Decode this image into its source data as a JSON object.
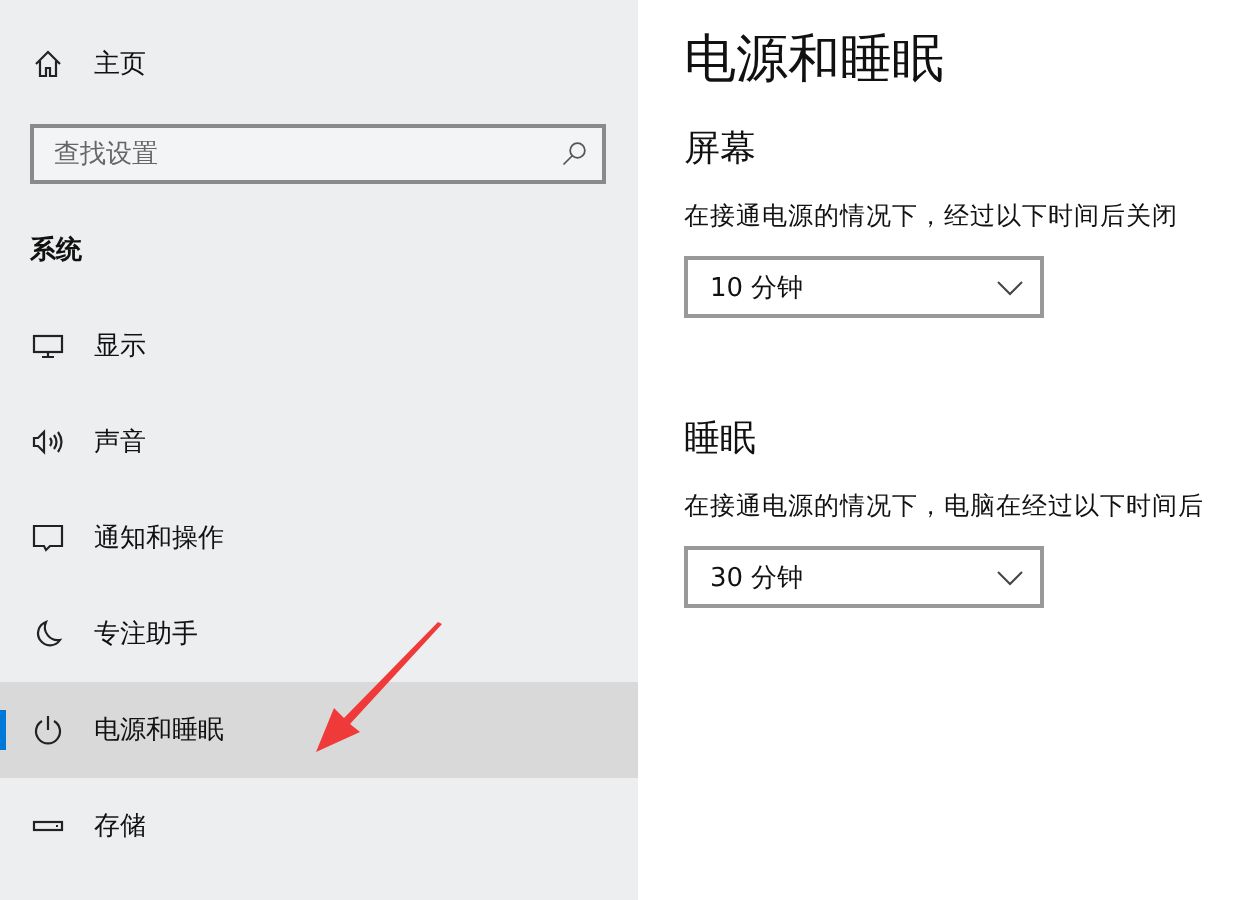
{
  "sidebar": {
    "home": "主页",
    "search": {
      "placeholder": "查找设置"
    },
    "section": "系统",
    "items": [
      {
        "label": "显示",
        "selected": false
      },
      {
        "label": "声音",
        "selected": false
      },
      {
        "label": "通知和操作",
        "selected": false
      },
      {
        "label": "专注助手",
        "selected": false
      },
      {
        "label": "电源和睡眠",
        "selected": true
      },
      {
        "label": "存储",
        "selected": false
      }
    ]
  },
  "main": {
    "title": "电源和睡眠",
    "sections": [
      {
        "heading": "屏幕",
        "label": "在接通电源的情况下，经过以下时间后关闭",
        "value": "10 分钟"
      },
      {
        "heading": "睡眠",
        "label": "在接通电源的情况下，电脑在经过以下时间后",
        "value": "30 分钟"
      }
    ]
  }
}
